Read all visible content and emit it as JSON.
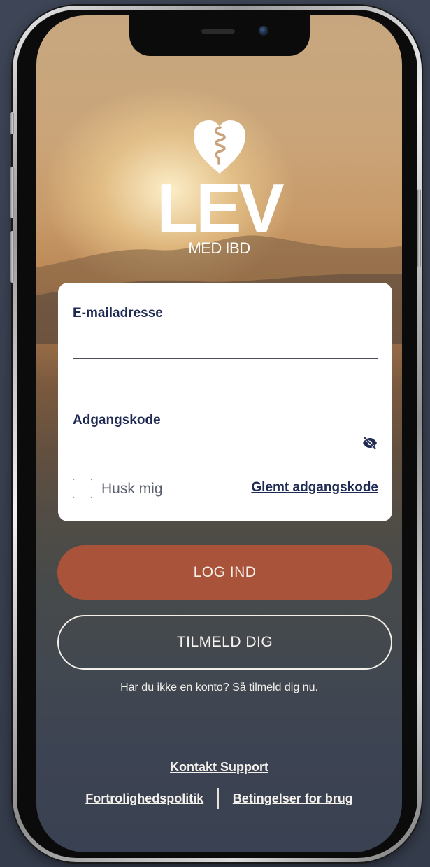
{
  "logo": {
    "wordmark": "LEV",
    "subtitle": "MED IBD"
  },
  "login_form": {
    "email": {
      "label": "E-mailadresse",
      "value": "",
      "placeholder": ""
    },
    "password": {
      "label": "Adgangskode",
      "value": "",
      "placeholder": "",
      "toggle_icon": "eye-slash-icon"
    },
    "remember": {
      "label": "Husk mig",
      "checked": false
    },
    "forgot_label": "Glemt adgangskode"
  },
  "actions": {
    "login_label": "LOG IND",
    "signup_label": "TILMELD DIG",
    "signup_hint": "Har du ikke en konto? Så tilmeld dig nu."
  },
  "footer": {
    "support_label": "Kontakt Support",
    "privacy_label": "Fortrolighedspolitik",
    "terms_label": "Betingelser for brug"
  },
  "colors": {
    "primary_button": "#a9533b",
    "text_dark": "#1f2a52",
    "card_background": "#ffffff"
  }
}
